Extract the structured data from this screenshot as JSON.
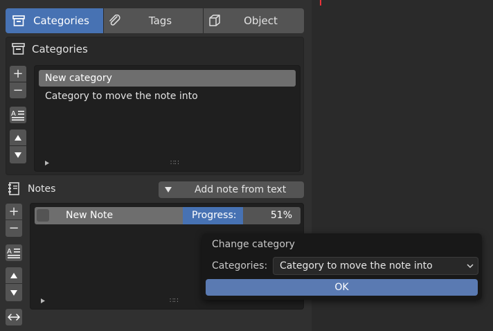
{
  "tabs": [
    {
      "label": "Categories",
      "icon": "archive-box-icon",
      "active": true
    },
    {
      "label": "Tags",
      "icon": "paperclip-icon",
      "active": false
    },
    {
      "label": "Object",
      "icon": "cube-icon",
      "active": false
    }
  ],
  "categories_panel": {
    "header": "Categories",
    "items": [
      "New category",
      "Category to move the note into"
    ],
    "selected_index": 0
  },
  "notes_panel": {
    "header": "Notes",
    "add_from_text_label": "Add note from text",
    "note": {
      "name": "New Note",
      "checked": false,
      "progress_label": "Progress:",
      "progress_value": "51%",
      "progress_fraction": 0.51
    }
  },
  "popup": {
    "title": "Change category",
    "field_label": "Categories:",
    "selected_value": "Category to move the note into",
    "ok_label": "OK"
  },
  "colors": {
    "accent_blue": "#4772b3",
    "ok_button": "#5a7ab2",
    "cursor_red": "#e8333a"
  }
}
